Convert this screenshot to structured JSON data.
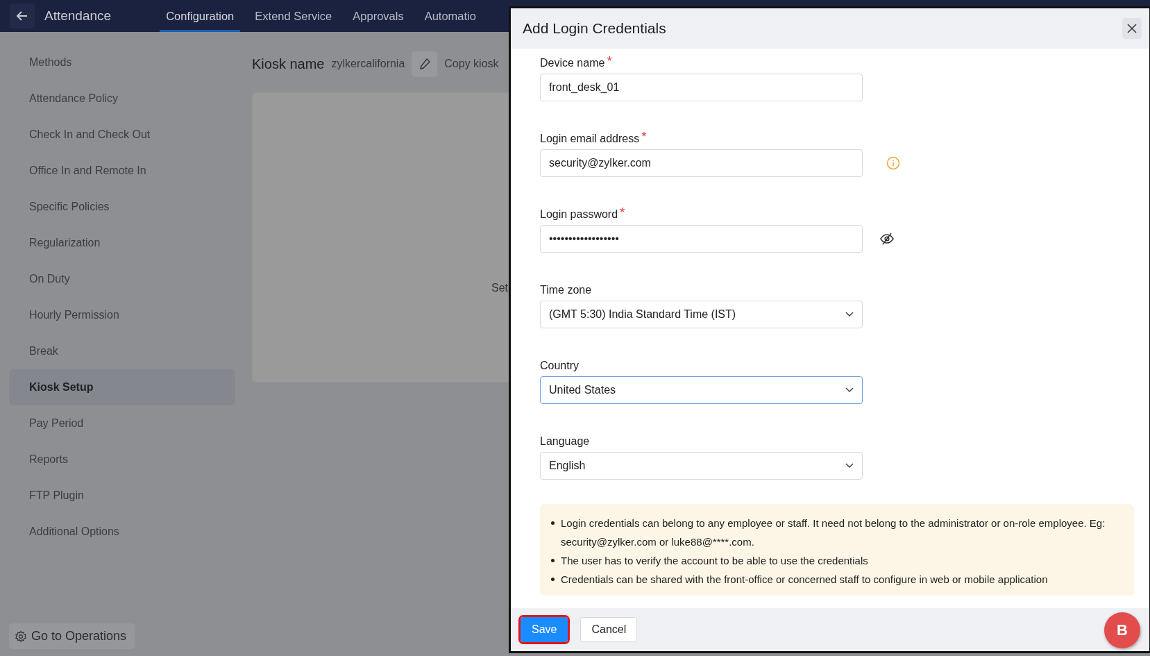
{
  "top_bar": {
    "title": "Attendance",
    "tabs": [
      {
        "label": "Configuration",
        "selected": true
      },
      {
        "label": "Extend Service",
        "selected": false
      },
      {
        "label": "Approvals",
        "selected": false
      },
      {
        "label": "Automatio",
        "selected": false
      }
    ]
  },
  "sidebar": {
    "items": [
      {
        "label": "Methods",
        "selected": false
      },
      {
        "label": "Attendance Policy",
        "selected": false
      },
      {
        "label": "Check In and Check Out",
        "selected": false
      },
      {
        "label": "Office In and Remote In",
        "selected": false
      },
      {
        "label": "Specific Policies",
        "selected": false
      },
      {
        "label": "Regularization",
        "selected": false
      },
      {
        "label": "On Duty",
        "selected": false
      },
      {
        "label": "Hourly Permission",
        "selected": false
      },
      {
        "label": "Break",
        "selected": false
      },
      {
        "label": "Kiosk Setup",
        "selected": true
      },
      {
        "label": "Pay Period",
        "selected": false
      },
      {
        "label": "Reports",
        "selected": false
      },
      {
        "label": "FTP Plugin",
        "selected": false
      },
      {
        "label": "Additional Options",
        "selected": false
      }
    ],
    "footer_button": "Go to Operations"
  },
  "main": {
    "heading": "Kiosk name",
    "kiosk_name": "zylkercalifornia",
    "copy_link": "Copy kiosk",
    "card_text": "Set"
  },
  "dialog": {
    "title": "Add Login Credentials",
    "fields": [
      {
        "label": "Device name",
        "required_mark": "*",
        "kind": "text",
        "value": "front_desk_01",
        "focused": false
      },
      {
        "label": "Login email address",
        "required_mark": "*",
        "kind": "email",
        "value": "security@zylker.com",
        "focused": false
      },
      {
        "label": "Login password",
        "required_mark": "*",
        "kind": "password",
        "value": "••••••••••••••••••",
        "focused": false
      },
      {
        "label": "Time zone",
        "kind": "select",
        "value": "(GMT 5:30) India Standard Time (IST)",
        "focused": false
      },
      {
        "label": "Country",
        "kind": "select",
        "value": "United States",
        "focused": true
      },
      {
        "label": "Language",
        "kind": "select",
        "value": "English",
        "focused": false
      }
    ],
    "notes": [
      "Login credentials can belong to any employee or staff. It need not belong to the administrator or on-role employee. Eg: security@zylker.com or luke88@****.com.",
      "The user has to verify the account to be able to use the credentials",
      "Credentials can be shared with the front-office or concerned staff to configure in web or mobile application"
    ],
    "buttons": [
      {
        "label": "Save",
        "primary": true,
        "highlighted": true
      },
      {
        "label": "Cancel",
        "primary": false,
        "highlighted": false
      }
    ],
    "badge": "B"
  }
}
